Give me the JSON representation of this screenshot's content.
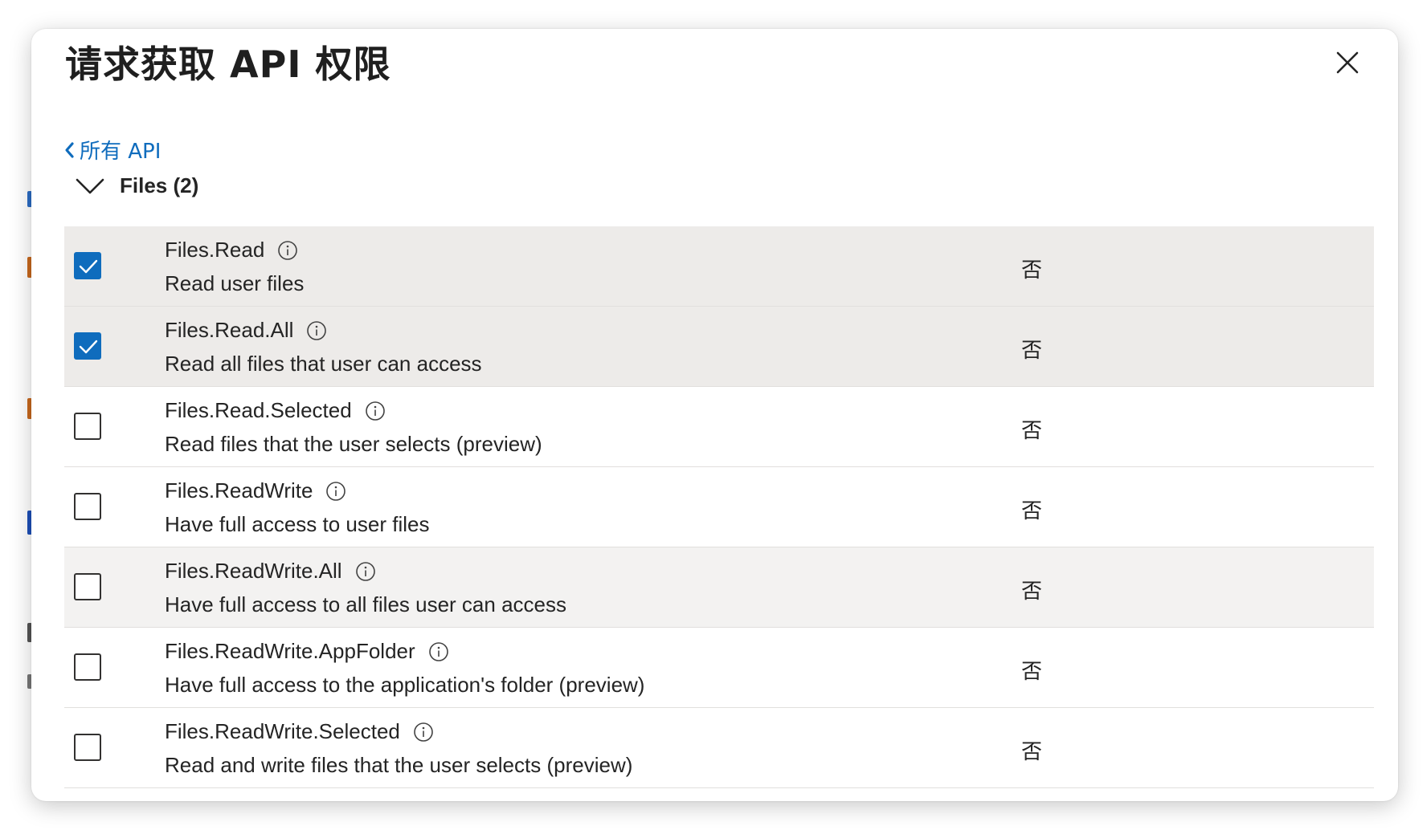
{
  "dialog": {
    "title": "请求获取 API 权限",
    "back_link": "所有 API",
    "group_label": "Files (2)",
    "accent_color": "#0f6cbd"
  },
  "permissions": [
    {
      "name": "Files.Read",
      "description": "Read user files",
      "admin_consent": "否",
      "checked": true
    },
    {
      "name": "Files.Read.All",
      "description": "Read all files that user can access",
      "admin_consent": "否",
      "checked": true
    },
    {
      "name": "Files.Read.Selected",
      "description": "Read files that the user selects (preview)",
      "admin_consent": "否",
      "checked": false
    },
    {
      "name": "Files.ReadWrite",
      "description": "Have full access to user files",
      "admin_consent": "否",
      "checked": false
    },
    {
      "name": "Files.ReadWrite.All",
      "description": "Have full access to all files user can access",
      "admin_consent": "否",
      "checked": false
    },
    {
      "name": "Files.ReadWrite.AppFolder",
      "description": "Have full access to the application's folder (preview)",
      "admin_consent": "否",
      "checked": false
    },
    {
      "name": "Files.ReadWrite.Selected",
      "description": "Read and write files that the user selects (preview)",
      "admin_consent": "否",
      "checked": false
    }
  ]
}
